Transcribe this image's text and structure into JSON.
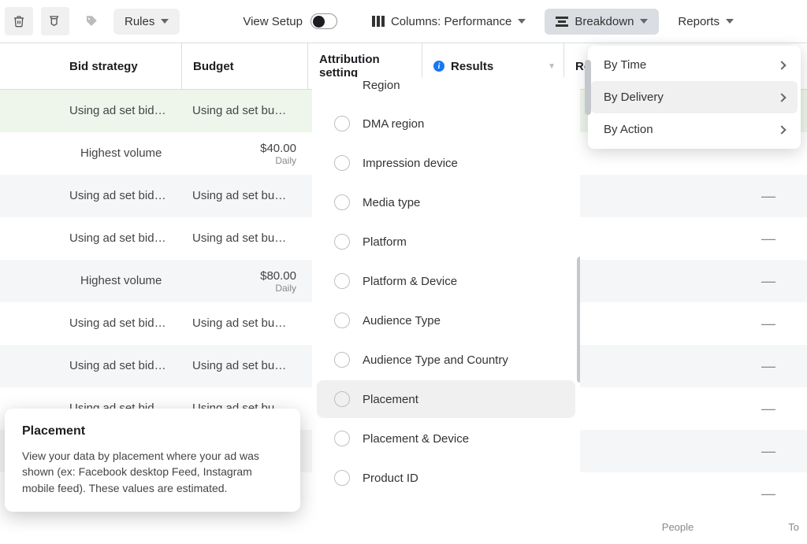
{
  "toolbar": {
    "rules": "Rules",
    "view_setup": "View Setup",
    "columns_label": "Columns: Performance",
    "breakdown": "Breakdown",
    "reports": "Reports"
  },
  "headers": {
    "bid": "Bid strategy",
    "budget": "Budget",
    "attribution": "Attribution setting",
    "results": "Results",
    "reach": "Rea"
  },
  "rows": [
    {
      "bid": "Using ad set bid…",
      "budget_text": "Using ad set bu…",
      "reach": "",
      "green": true,
      "indent": false
    },
    {
      "bid": "Highest volume",
      "amount": "$40.00",
      "freq": "Daily",
      "reach": "",
      "indent": true
    },
    {
      "bid": "Using ad set bid…",
      "budget_text": "Using ad set bu…",
      "reach": "—",
      "striped": true,
      "indent": false
    },
    {
      "bid": "Using ad set bid…",
      "budget_text": "Using ad set bu…",
      "reach": "—",
      "indent": false
    },
    {
      "bid": "Highest volume",
      "amount": "$80.00",
      "freq": "Daily",
      "reach": "—",
      "striped": true,
      "indent": true
    },
    {
      "bid": "Using ad set bid…",
      "budget_text": "Using ad set bu…",
      "reach": "—",
      "indent": false
    },
    {
      "bid": "Using ad set bid…",
      "budget_text": "Using ad set bu…",
      "reach": "—",
      "striped": true,
      "indent": false
    },
    {
      "bid": "Using ad set bid…",
      "budget_text": "Using ad set bu…",
      "reach": "—",
      "indent": false
    },
    {
      "bid": "",
      "budget_text": "",
      "reach": "—",
      "striped": true,
      "indent": false
    },
    {
      "bid": "",
      "budget_text": "",
      "reach": "—",
      "indent": false
    }
  ],
  "delivery_options": [
    "Region",
    "DMA region",
    "Impression device",
    "Media type",
    "Platform",
    "Platform & Device",
    "Audience Type",
    "Audience Type and Country",
    "Placement",
    "Placement & Device",
    "Product ID"
  ],
  "delivery_hover": "Placement",
  "breakdown_menu": [
    "By Time",
    "By Delivery",
    "By Action"
  ],
  "breakdown_active": "By Delivery",
  "tooltip": {
    "title": "Placement",
    "body": "View your data by placement where your ad was shown (ex: Facebook desktop Feed, Instagram mobile feed). These values are estimated."
  },
  "footer": {
    "people": "People",
    "total": "To"
  }
}
